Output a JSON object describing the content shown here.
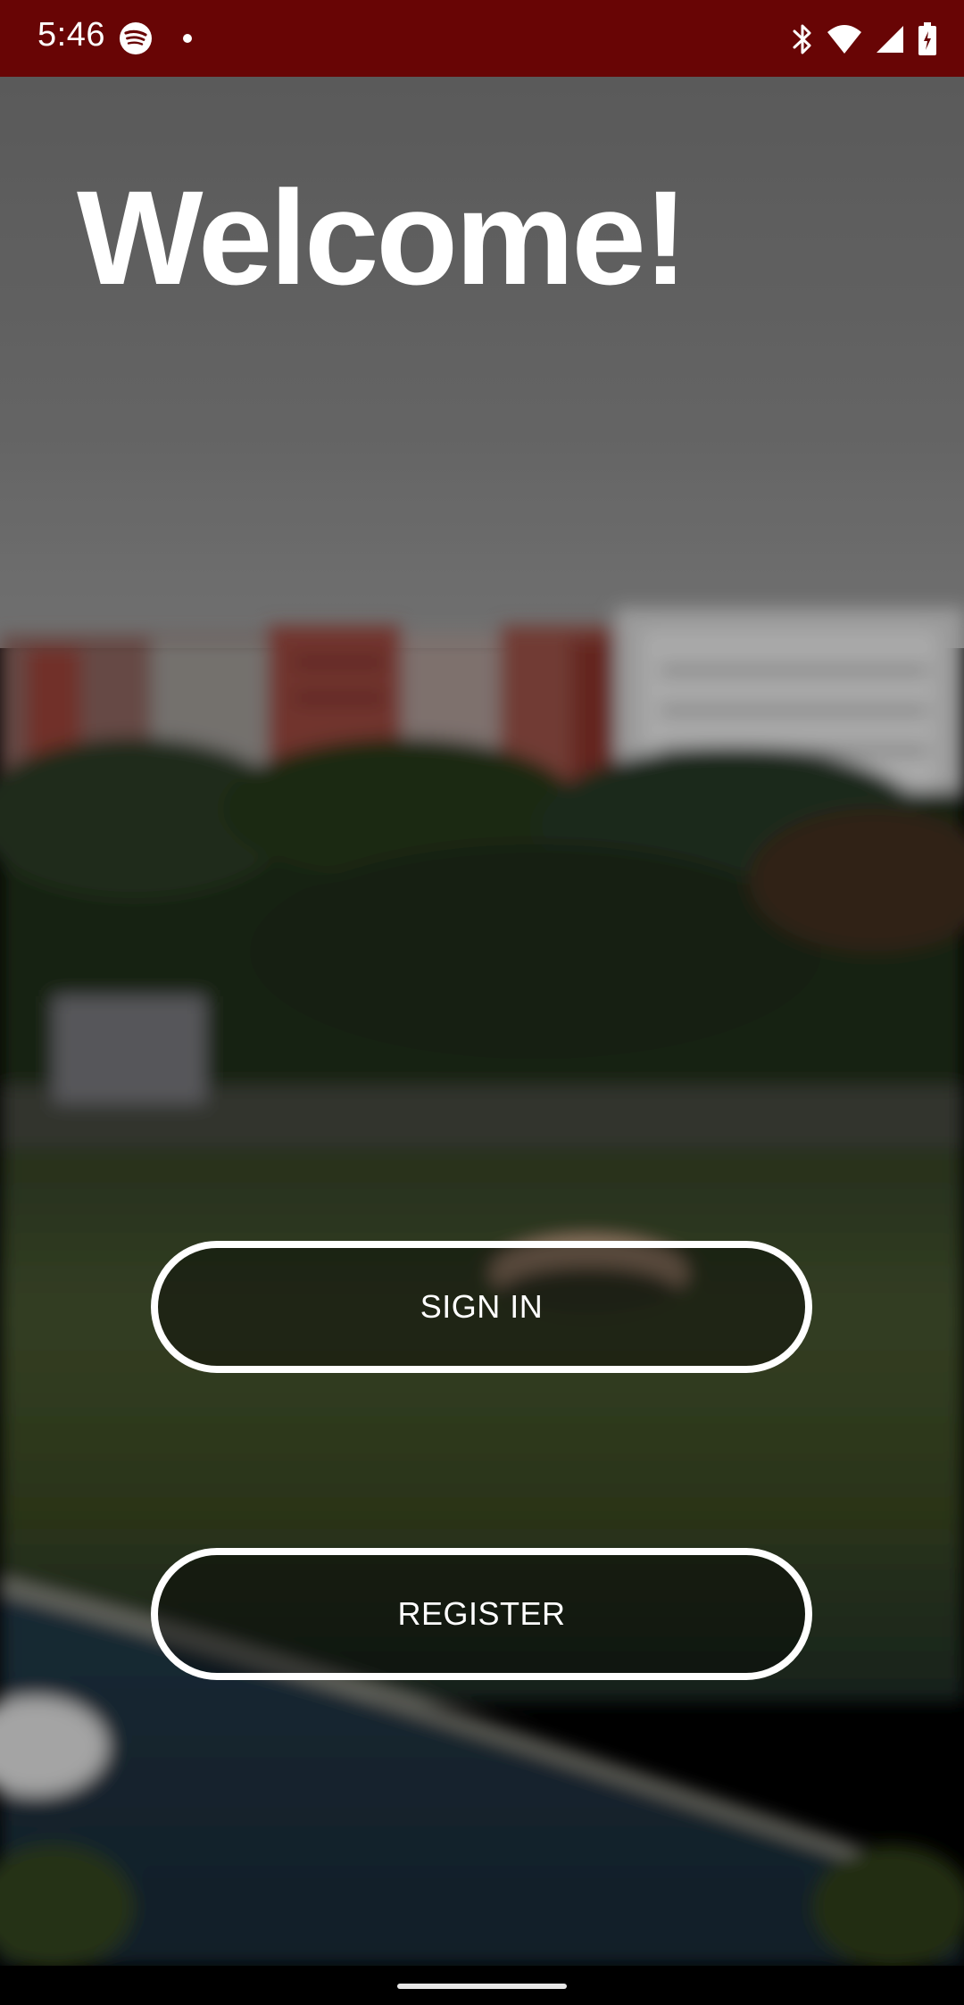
{
  "status_bar": {
    "time": "5:46",
    "icons": [
      "spotify-icon",
      "notification-dot-icon",
      "bluetooth-icon",
      "wifi-icon",
      "signal-icon",
      "battery-icon"
    ],
    "background_color": "#680505"
  },
  "screen": {
    "title": "Welcome!"
  },
  "buttons": {
    "sign_in": "SIGN IN",
    "register": "REGISTER"
  },
  "colors": {
    "accent": "#680505",
    "button_border": "#ffffff",
    "text": "#ffffff"
  }
}
